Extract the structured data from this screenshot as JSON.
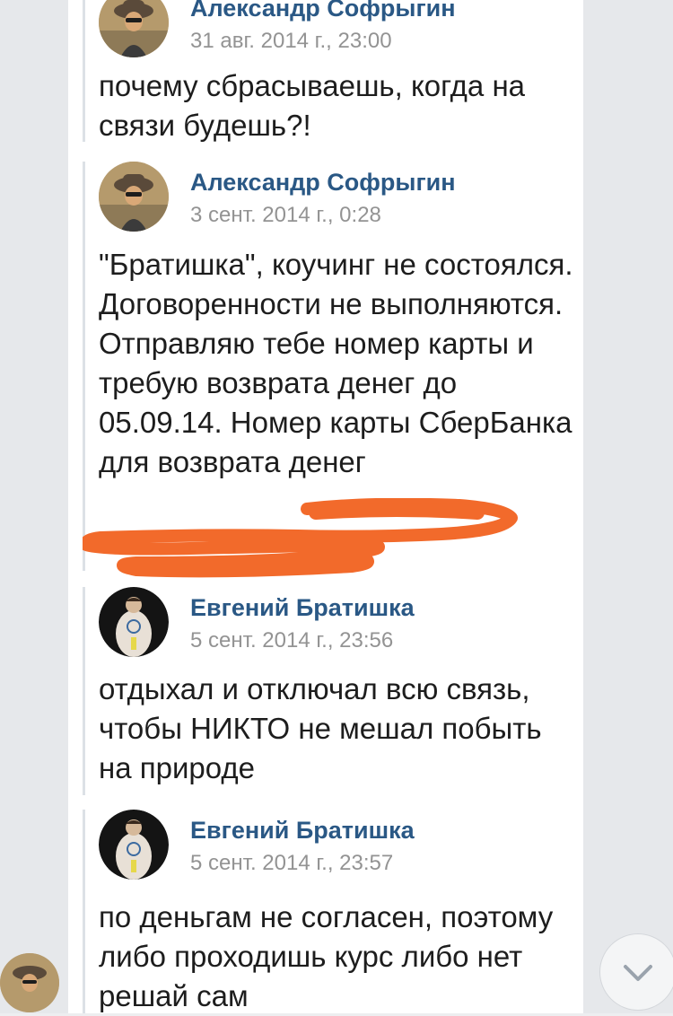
{
  "messages": [
    {
      "author": "Александр Софрыгин",
      "date": "31 авг. 2014 г., 23:00",
      "text": "почему сбрасываешь, когда на связи будешь?!"
    },
    {
      "author": "Александр Софрыгин",
      "date": "3 сент. 2014 г., 0:28",
      "text": "\"Братишка\", коучинг не состоялся. Договоренности не выполняются. Отправляю тебе номер карты и требую возврата денег до 05.09.14. Номер карты СберБанка для возврата денег"
    },
    {
      "author": "Евгений Братишка",
      "date": "5 сент. 2014 г., 23:56",
      "text": "отдыхал и отключал всю связь, чтобы НИКТО не мешал побыть на природе"
    },
    {
      "author": "Евгений Братишка",
      "date": "5 сент. 2014 г., 23:57",
      "text": "по деньгам не согласен, поэтому либо проходишь курс либо нет решай сам"
    }
  ],
  "colors": {
    "author": "#2a5885",
    "date": "#939393",
    "redaction": "#f26a2b"
  },
  "icons": {
    "scroll_down": "chevron-down-icon"
  }
}
